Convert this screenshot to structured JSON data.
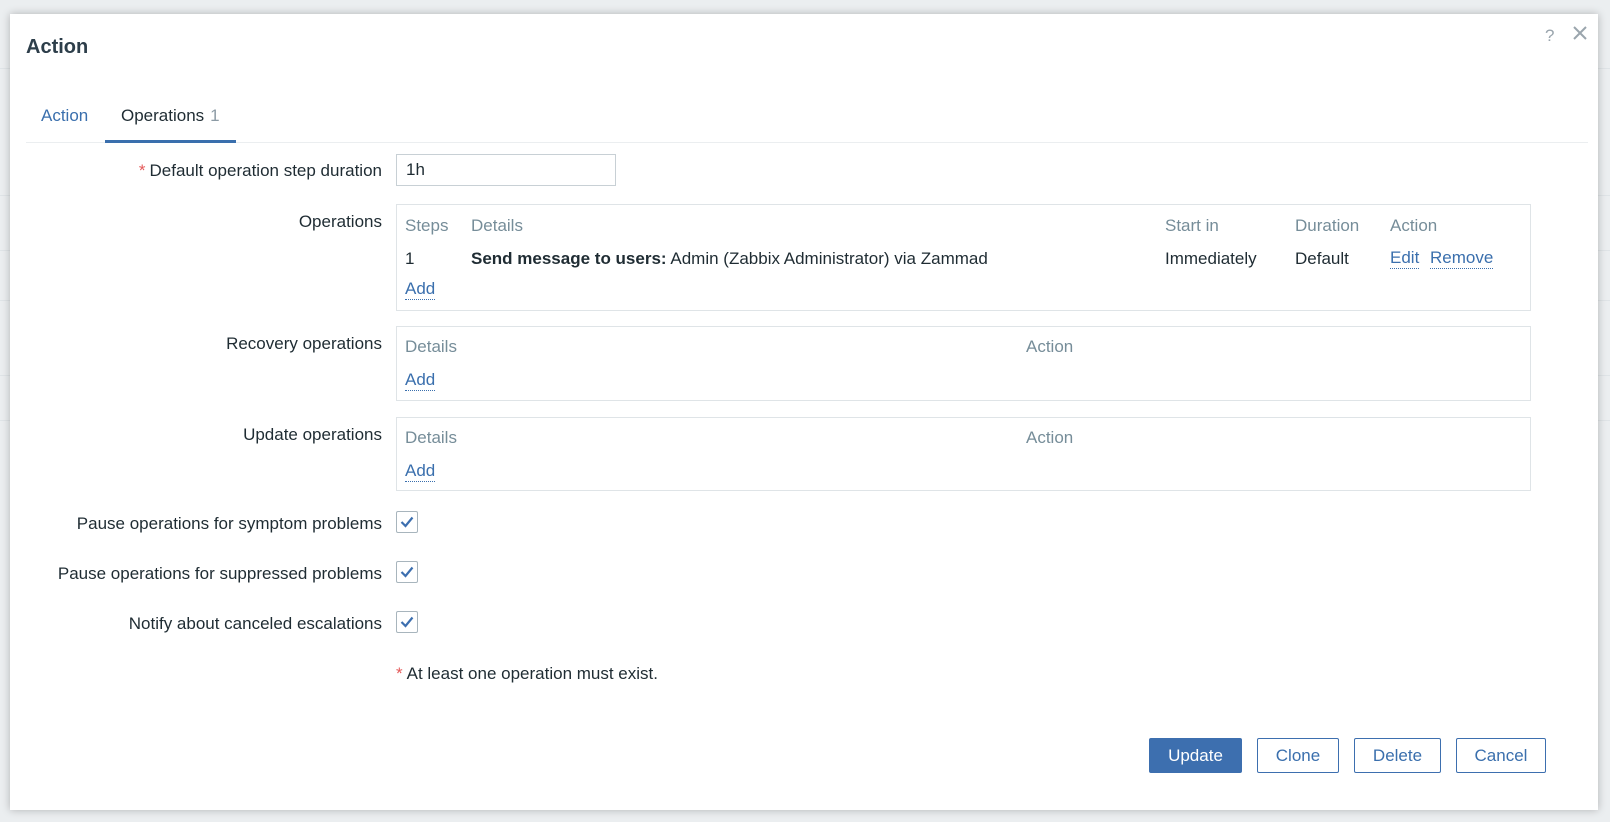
{
  "dialog": {
    "title": "Action",
    "help_label": "?"
  },
  "tabs": [
    {
      "label": "Action"
    },
    {
      "label": "Operations",
      "count": "1"
    }
  ],
  "form": {
    "step_duration": {
      "required_mark": "*",
      "label": "Default operation step duration",
      "value": "1h"
    },
    "operations": {
      "label": "Operations",
      "headers": {
        "steps": "Steps",
        "details": "Details",
        "start_in": "Start in",
        "duration": "Duration",
        "action": "Action"
      },
      "rows": [
        {
          "steps": "1",
          "details_bold": "Send message to users:",
          "details_text": "Admin (Zabbix Administrator) via Zammad",
          "start_in": "Immediately",
          "duration": "Default",
          "edit_label": "Edit",
          "remove_label": "Remove"
        }
      ],
      "add_label": "Add"
    },
    "recovery_operations": {
      "label": "Recovery operations",
      "headers": {
        "details": "Details",
        "action": "Action"
      },
      "add_label": "Add"
    },
    "update_operations": {
      "label": "Update operations",
      "headers": {
        "details": "Details",
        "action": "Action"
      },
      "add_label": "Add"
    },
    "checkboxes": [
      {
        "label": "Pause operations for symptom problems",
        "checked": true
      },
      {
        "label": "Pause operations for suppressed problems",
        "checked": true
      },
      {
        "label": "Notify about canceled escalations",
        "checked": true
      }
    ],
    "note": {
      "required_mark": "*",
      "text": "At least one operation must exist."
    }
  },
  "buttons": {
    "update": "Update",
    "clone": "Clone",
    "delete": "Delete",
    "cancel": "Cancel"
  },
  "colors": {
    "accent": "#3d6faf",
    "required": "#e45959",
    "header_text": "#768d99"
  },
  "icons": {
    "help": "help-icon",
    "close": "close-icon",
    "checkbox": "checkmark-icon"
  }
}
